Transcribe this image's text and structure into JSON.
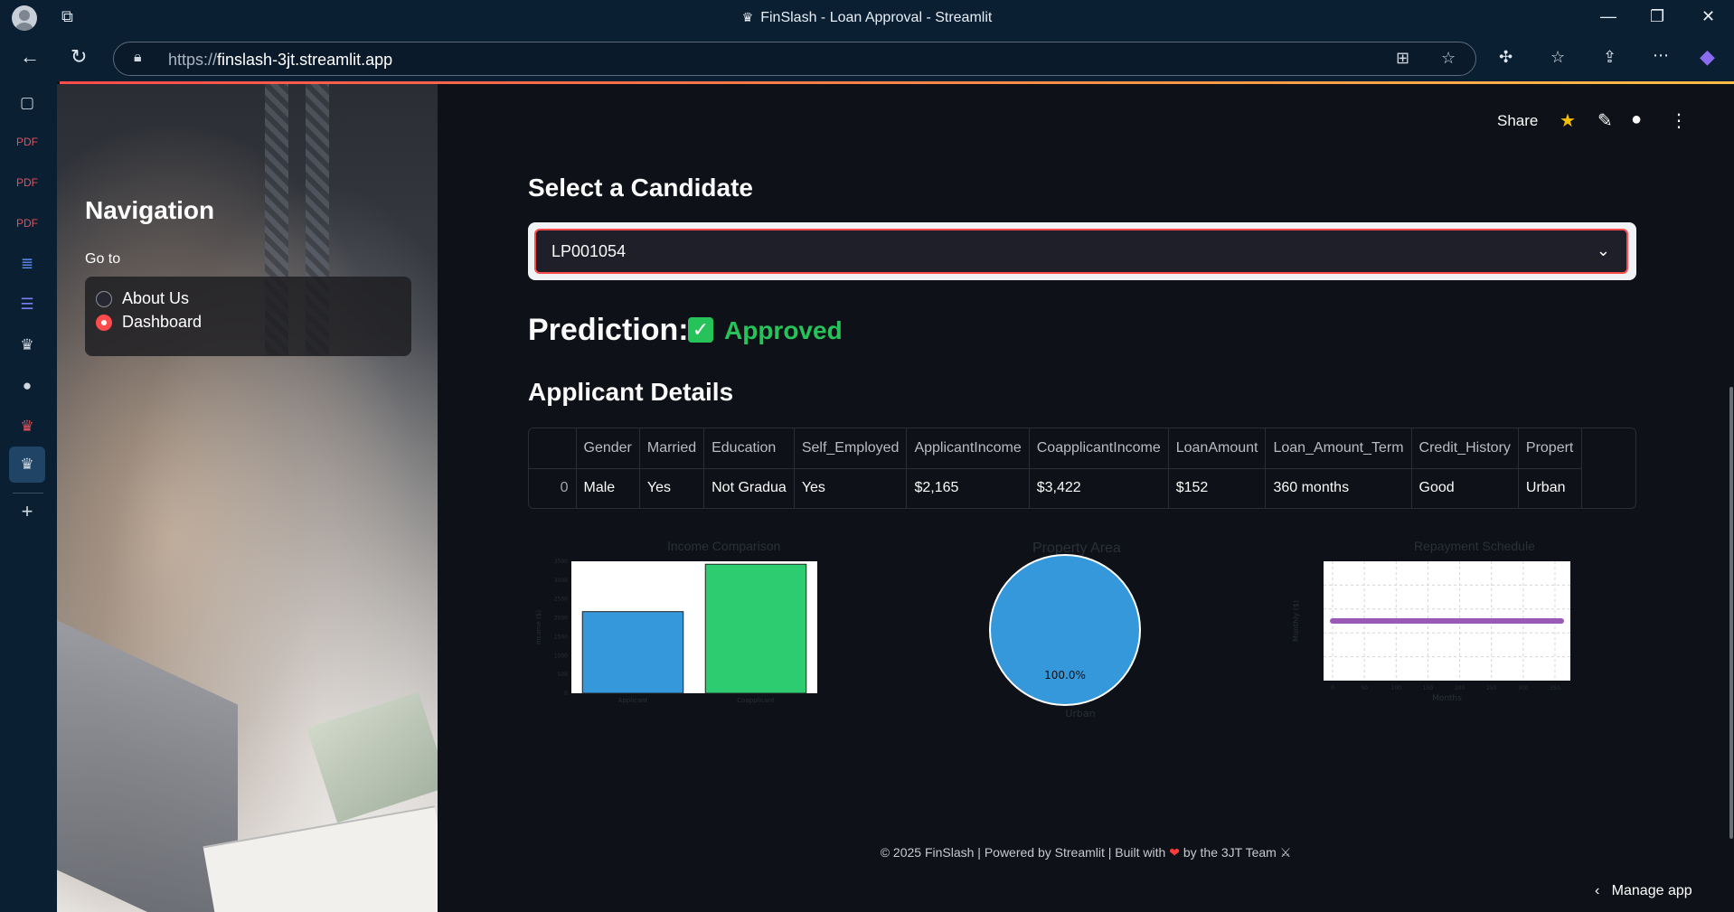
{
  "browser": {
    "title": "FinSlash - Loan Approval - Streamlit",
    "url_protocol": "https://",
    "url_host": "finslash-3jt.streamlit.app"
  },
  "sidebar": {
    "heading": "Navigation",
    "goto_label": "Go to",
    "options": [
      {
        "label": "About Us",
        "selected": false
      },
      {
        "label": "Dashboard",
        "selected": true
      }
    ]
  },
  "toolbar": {
    "share_label": "Share"
  },
  "select": {
    "heading": "Select a Candidate",
    "value": "LP001054"
  },
  "prediction": {
    "label": "Prediction:",
    "status": "Approved"
  },
  "details": {
    "heading": "Applicant Details",
    "columns": [
      "",
      "Gender",
      "Married",
      "Education",
      "Self_Employed",
      "ApplicantIncome",
      "CoapplicantIncome",
      "LoanAmount",
      "Loan_Amount_Term",
      "Credit_History",
      "Propert"
    ],
    "rows": [
      [
        "0",
        "Male",
        "Yes",
        "Not Gradua",
        "Yes",
        "$2,165",
        "$3,422",
        "$152",
        "360 months",
        "Good",
        "Urban"
      ]
    ]
  },
  "charts": {
    "income_title": "Income Comparison",
    "property_title": "Property Area",
    "repayment_title": "Repayment Schedule",
    "pie_pct": "100.0%",
    "pie_label": "Urban",
    "repay_xlabel": "Months",
    "repay_ylabel": "Monthly ($)"
  },
  "chart_data": [
    {
      "type": "bar",
      "title": "Income Comparison",
      "categories": [
        "Applicant",
        "Coapplicant"
      ],
      "values": [
        2165,
        3422
      ],
      "colors": [
        "#3498db",
        "#2ecc71"
      ],
      "ylabel": "Income ($)",
      "ylim": [
        0,
        3500
      ],
      "yticks": [
        0,
        500,
        1000,
        1500,
        2000,
        2500,
        3000,
        3500
      ]
    },
    {
      "type": "pie",
      "title": "Property Area",
      "categories": [
        "Urban"
      ],
      "values": [
        100.0
      ],
      "colors": [
        "#3498db"
      ]
    },
    {
      "type": "line",
      "title": "Repayment Schedule",
      "xlabel": "Months",
      "ylabel": "Monthly ($)",
      "x": [
        0,
        360
      ],
      "xticks": [
        0,
        50,
        100,
        150,
        200,
        250,
        300,
        350
      ],
      "color": "#9b59b6"
    }
  ],
  "footer": {
    "text_before": "© 2025 FinSlash | Powered by Streamlit | Built with",
    "text_after": "by the 3JT Team ⚔",
    "manage_app": "Manage app"
  }
}
